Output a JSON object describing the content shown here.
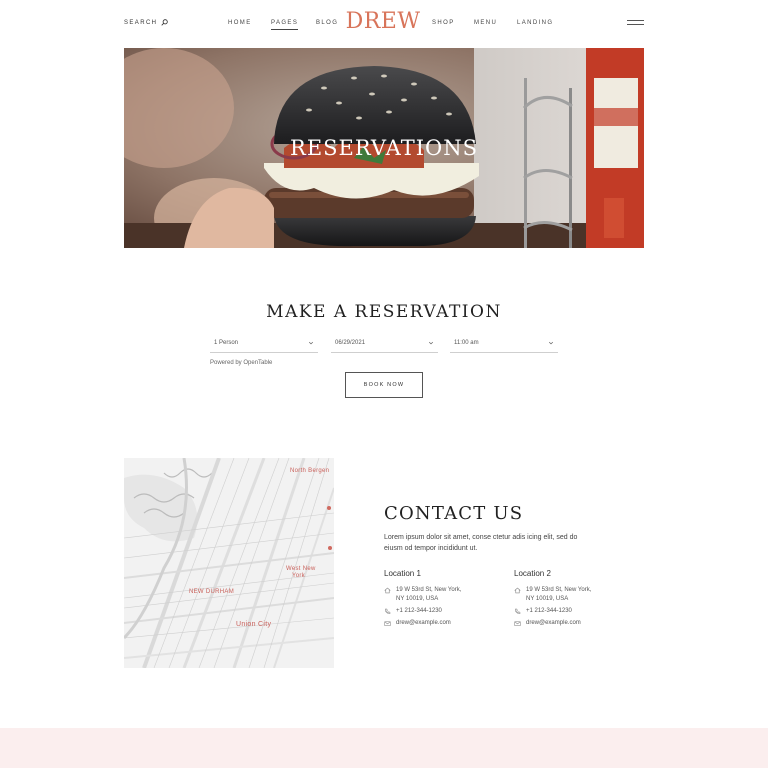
{
  "header": {
    "search_label": "SEARCH",
    "logo": "DREW",
    "nav": {
      "home": "HOME",
      "pages": "PAGES",
      "blog": "BLOG",
      "shop": "SHOP",
      "menu": "MENU",
      "landing": "LANDING"
    },
    "active_item": "PAGES",
    "icons": {
      "search": "search-icon",
      "menu": "hamburger-icon"
    }
  },
  "hero": {
    "title": "RESERVATIONS"
  },
  "reservation": {
    "heading": "MAKE A RESERVATION",
    "party_size": "1 Person",
    "date": "06/29/2021",
    "time": "11:00 am",
    "powered_by": "Powered by OpenTable",
    "book_button": "BOOK NOW"
  },
  "map": {
    "labels": {
      "north_bergen": "North Bergen",
      "west_new_york_1": "West New",
      "west_new_york_2": "York",
      "new_durham": "NEW DURHAM",
      "union_city": "Union City"
    }
  },
  "contact": {
    "heading": "CONTACT US",
    "description": "Lorem ipsum dolor sit amet, conse ctetur adis icing elit, sed do eiusm od tempor incididunt ut.",
    "locations": [
      {
        "title": "Location 1",
        "address_line1": "19 W 53rd St, New York,",
        "address_line2": "NY 10019, USA",
        "phone": "+1 212-344-1230",
        "email": "drew@example.com"
      },
      {
        "title": "Location 2",
        "address_line1": "19 W 53rd St, New York,",
        "address_line2": "NY 10019, USA",
        "phone": "+1 212-344-1230",
        "email": "drew@example.com"
      }
    ]
  },
  "colors": {
    "brand": "#d8745a",
    "map_label": "#c9605a",
    "footer_band": "#fbeeee"
  }
}
